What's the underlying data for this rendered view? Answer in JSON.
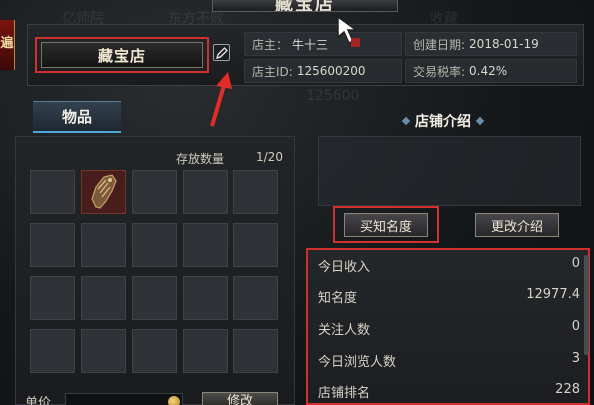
{
  "window": {
    "title": "藏宝店"
  },
  "side_ribbon": {
    "char": "遍"
  },
  "shop": {
    "name": "藏宝店",
    "owner_label": "店主：",
    "owner_value": "牛十三",
    "owner_id_label": "店主ID:",
    "owner_id_value": "125600200",
    "created_label": "创建日期:",
    "created_value": "2018-01-19",
    "tax_label": "交易税率:",
    "tax_value": "0.42%"
  },
  "items": {
    "tab_label": "物品",
    "storage_label": "存放数量",
    "storage_count": "1/20",
    "price_label": "单价",
    "modify_button": "修改"
  },
  "intro": {
    "title": "店铺介绍",
    "buy_fame_button": "买知名度",
    "change_intro_button": "更改介绍"
  },
  "stats": [
    {
      "label": "今日收入",
      "value": "0"
    },
    {
      "label": "知名度",
      "value": "12977.4"
    },
    {
      "label": "关注人数",
      "value": "0"
    },
    {
      "label": "今日浏览人数",
      "value": "3"
    },
    {
      "label": "店铺排名",
      "value": "228"
    }
  ],
  "icons": [
    "edit-icon",
    "cursor-icon",
    "arrow-icon",
    "gauntlet-icon",
    "coin-icon"
  ],
  "colors": {
    "highlight": "#d2302e",
    "tab_accent": "#4fa6d8"
  }
}
